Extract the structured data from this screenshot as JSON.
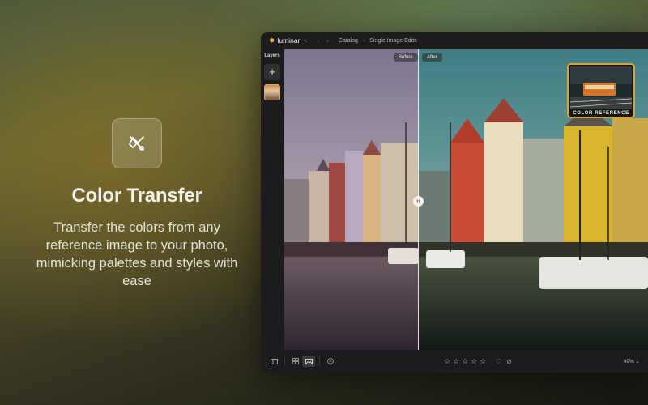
{
  "hero": {
    "icon": "color-transfer-icon",
    "title": "Color Transfer",
    "description": "Transfer the colors from any reference image to your photo, mimicking palettes and styles with ease"
  },
  "app": {
    "brand": "luminar",
    "breadcrumb": [
      "Catalog",
      "Single Image Edits"
    ],
    "layers_label": "Layers",
    "add_layer_label": "+",
    "before_label": "Before",
    "after_label": "After",
    "reference_label": "COLOR REFERENCE",
    "zoom_label": "49% ⌄",
    "rating_stars": 5,
    "accent_color": "#d9a52b"
  }
}
